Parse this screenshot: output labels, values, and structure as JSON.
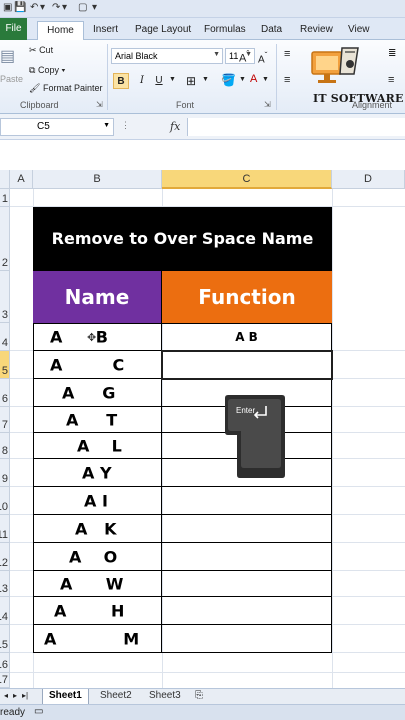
{
  "ribbon_tabs": [
    "File",
    "Home",
    "Insert",
    "Page Layout",
    "Formulas",
    "Data",
    "Review",
    "View"
  ],
  "clipboard": {
    "cut": "Cut",
    "copy": "Copy",
    "paste": "Paste",
    "format_painter": "Format Painter",
    "group_label": "Clipboard"
  },
  "font": {
    "family": "Arial Black",
    "size": "11",
    "group_label": "Font",
    "bold": "B",
    "italic": "I",
    "underline": "U"
  },
  "alignment": {
    "group_label": "Alignment"
  },
  "logo": {
    "text": "IT SOFTWARE"
  },
  "formula_bar": {
    "name_box": "C5",
    "fx": "fx",
    "formula": ""
  },
  "columns": [
    "A",
    "B",
    "C",
    "D"
  ],
  "rows": [
    "1",
    "2",
    "3",
    "4",
    "5",
    "6",
    "7",
    "8",
    "9",
    "10",
    "11",
    "12",
    "13",
    "14",
    "15",
    "16",
    "17"
  ],
  "table": {
    "title": "Remove to Over Space Name",
    "header_name": "Name",
    "header_function": "Function",
    "names": [
      "A      B",
      "A         C",
      "A     G",
      "A     T",
      "A    L",
      "A Y",
      "A I",
      "A   K",
      "A    O",
      "A      W",
      "A        H",
      "A            M"
    ],
    "results": [
      "A B",
      "",
      "",
      "",
      "",
      "",
      "",
      "",
      "",
      "",
      "",
      ""
    ]
  },
  "enter_key": {
    "label": "Enter"
  },
  "sheets": [
    "Sheet1",
    "Sheet2",
    "Sheet3"
  ],
  "status": {
    "mode": "ready"
  },
  "colors": {
    "title_bg": "#000000",
    "name_header_bg": "#7030a0",
    "function_header_bg": "#ec6e10",
    "file_tab": "#2a7a3b",
    "selection": "#f8d77a"
  }
}
